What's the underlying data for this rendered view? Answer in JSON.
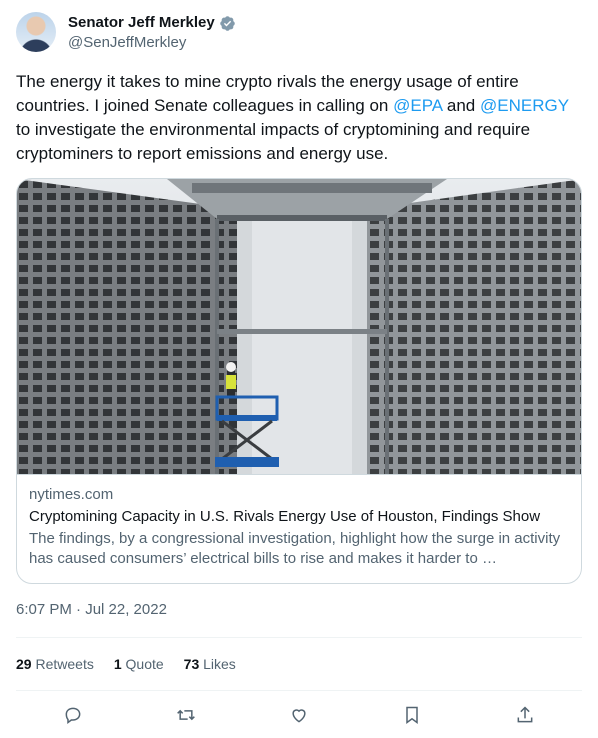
{
  "author": {
    "name": "Senator Jeff Merkley",
    "handle": "@SenJeffMerkley",
    "verified_color": "#829aab"
  },
  "tweet": {
    "text_part1": "The energy it takes to mine crypto rivals the energy usage of entire countries. I joined Senate colleagues in calling on ",
    "mention1": "@EPA",
    "text_part2": " and ",
    "mention2": "@ENERGY",
    "text_part3": " to investigate the environmental impacts of cryptomining and require cryptominers to report emissions and energy use.",
    "mention_color": "#1d9bf0"
  },
  "card": {
    "domain": "nytimes.com",
    "title": "Cryptomining Capacity in U.S. Rivals Energy Use of Houston, Findings Show",
    "description": "The findings, by a congressional investigation, highlight how the surge in activity has caused consumers’ electrical bills to rise and makes it harder to …"
  },
  "timestamp": "6:07 PM · Jul 22, 2022",
  "stats": {
    "retweets_count": "29",
    "retweets_label": "Retweets",
    "quotes_count": "1",
    "quotes_label": "Quote",
    "likes_count": "73",
    "likes_label": "Likes"
  },
  "actions": [
    "reply-icon",
    "retweet-icon",
    "like-icon",
    "bookmark-icon",
    "share-icon"
  ]
}
